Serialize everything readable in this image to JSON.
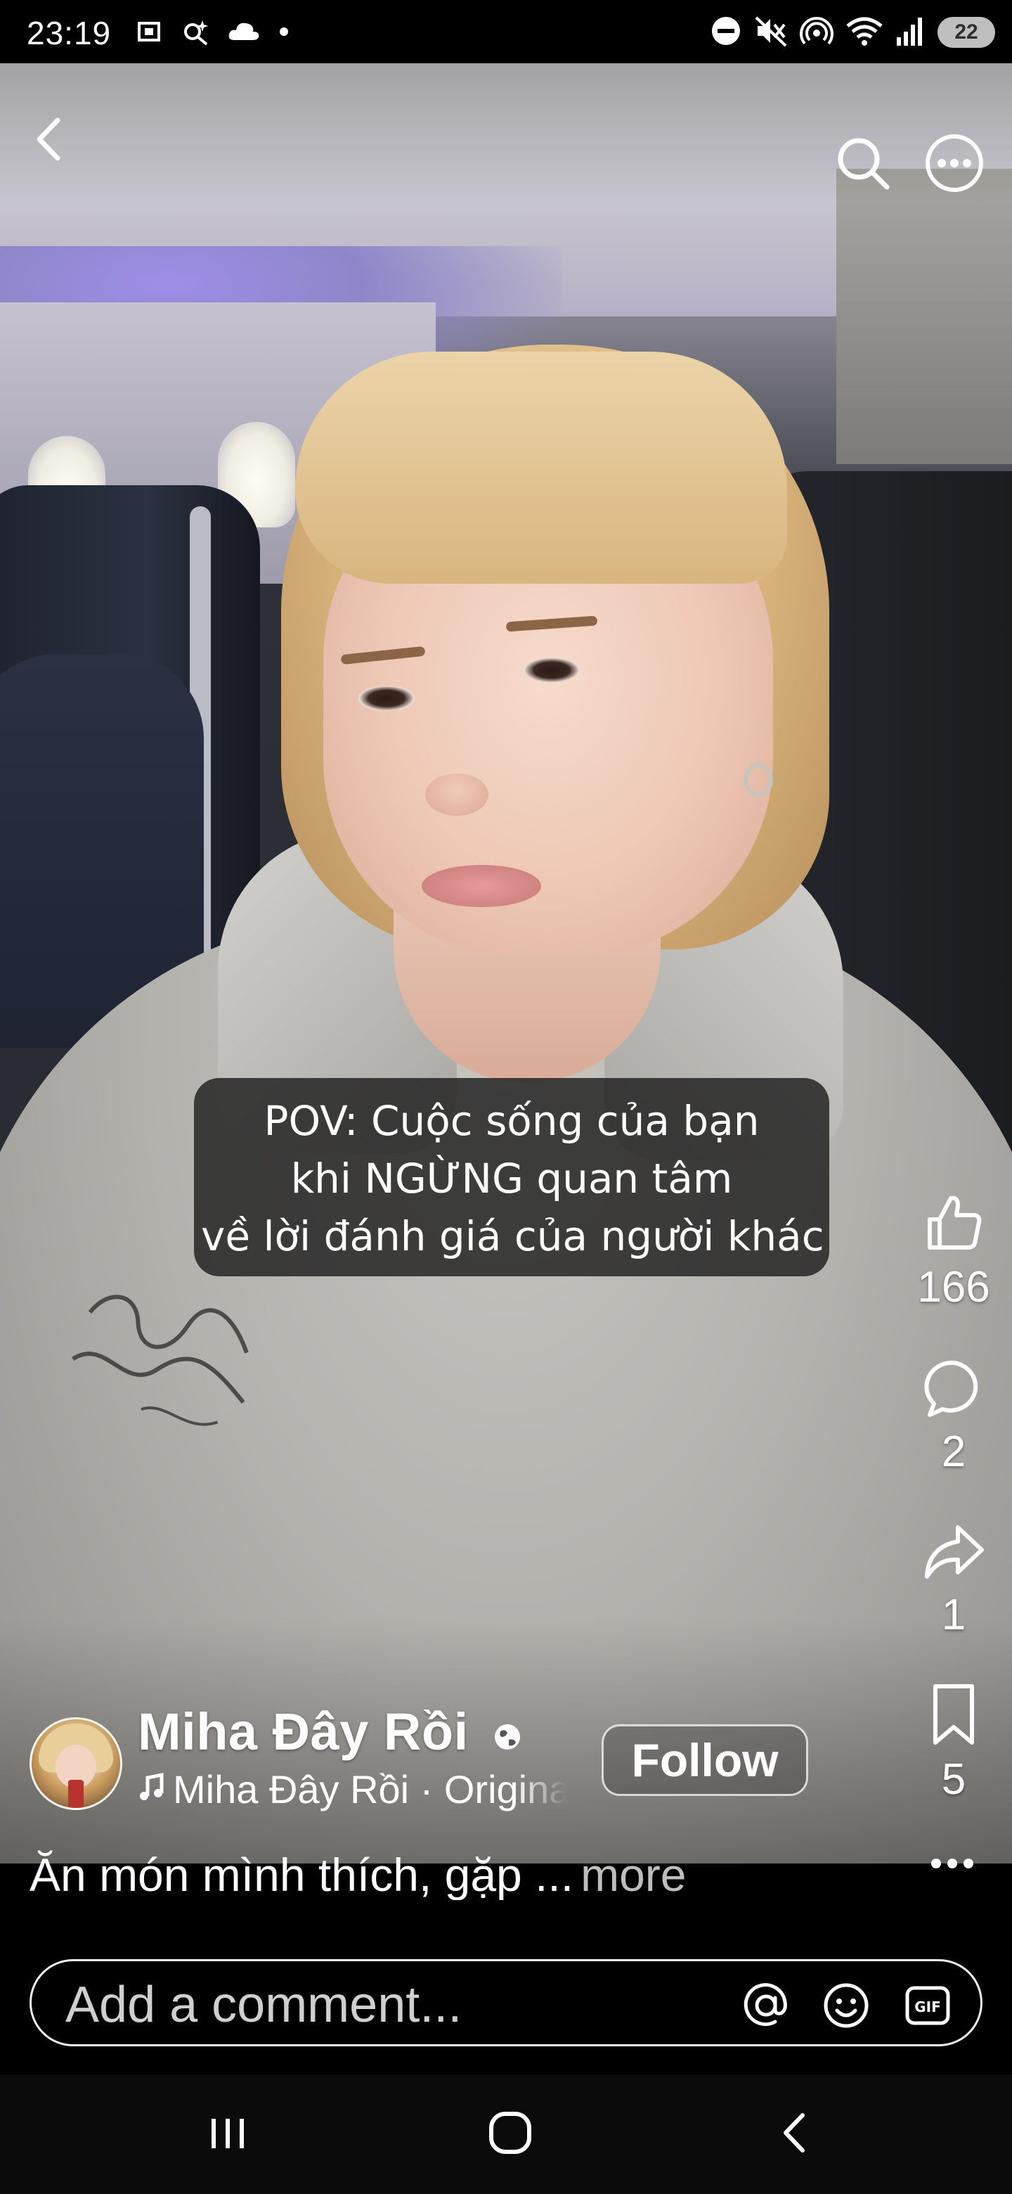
{
  "status_bar": {
    "time": "23:19",
    "battery": "22",
    "left_icons": [
      "screenshot-icon",
      "magic-icon",
      "cloud-icon",
      "dot-icon"
    ],
    "right_icons": [
      "do-not-disturb-icon",
      "mute-icon",
      "hotspot-icon",
      "wifi-icon",
      "signal-icon"
    ]
  },
  "top_bar": {
    "icons": [
      "back-icon",
      "search-icon",
      "more-icon"
    ]
  },
  "caption": {
    "lines": [
      "POV: Cuộc sống của bạn",
      "khi NGỪNG quan tâm",
      "về lời đánh giá của người khác"
    ]
  },
  "actions": {
    "likes": "166",
    "comments": "2",
    "shares": "1",
    "saves": "5"
  },
  "author": {
    "name": "Miha Đây Rồi",
    "audio": "Miha Đây Rồi · Original audio",
    "follow_label": "Follow"
  },
  "description": {
    "text": "Ăn món mình thích, gặp ...",
    "more_label": "more"
  },
  "comment_box": {
    "placeholder": "Add a comment..."
  },
  "nav": {
    "icons": [
      "recents-icon",
      "home-icon",
      "back-icon"
    ]
  },
  "colors": {
    "background": "#000000",
    "text": "#ffffff",
    "caption_bg": "#1e1e1e",
    "battery_pill": "#bfbfbf"
  }
}
